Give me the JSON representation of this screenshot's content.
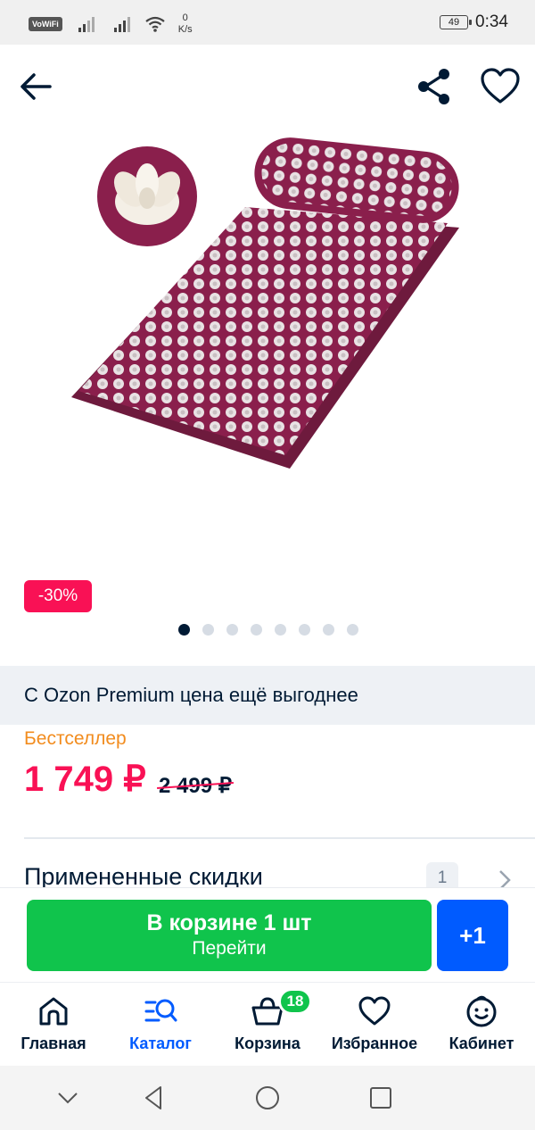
{
  "status_bar": {
    "vowifi": "VoWiFi",
    "net_speed_value": "0",
    "net_speed_unit": "K/s",
    "battery": "49",
    "time": "0:34"
  },
  "header": {
    "back_icon": "arrow-left-icon",
    "share_icon": "share-icon",
    "favorite_icon": "heart-icon"
  },
  "product": {
    "discount_badge": "-30%",
    "image_count": 8,
    "active_image_index": 0,
    "premium_text": "С Ozon Premium цена ещё выгоднее",
    "bestseller_label": "Бестселлер",
    "price": "1 749 ₽",
    "old_price": "2 499 ₽",
    "applied_discounts_label": "Примененные скидки",
    "applied_discounts_count": "1"
  },
  "actions": {
    "cart_title": "В корзине 1 шт",
    "cart_subtitle": "Перейти",
    "plus_one": "+1"
  },
  "bottom_nav": {
    "items": [
      {
        "label": "Главная",
        "icon": "home-icon"
      },
      {
        "label": "Каталог",
        "icon": "catalog-search-icon"
      },
      {
        "label": "Корзина",
        "icon": "cart-basket-icon",
        "badge": "18"
      },
      {
        "label": "Избранное",
        "icon": "heart-icon"
      },
      {
        "label": "Кабинет",
        "icon": "profile-face-icon"
      }
    ],
    "active_index": 1
  },
  "colors": {
    "accent_blue": "#005bff",
    "price_red": "#f91155",
    "cart_green": "#10c44c",
    "bestseller_orange": "#f28c1e",
    "mat_purple": "#8a1f4c"
  }
}
